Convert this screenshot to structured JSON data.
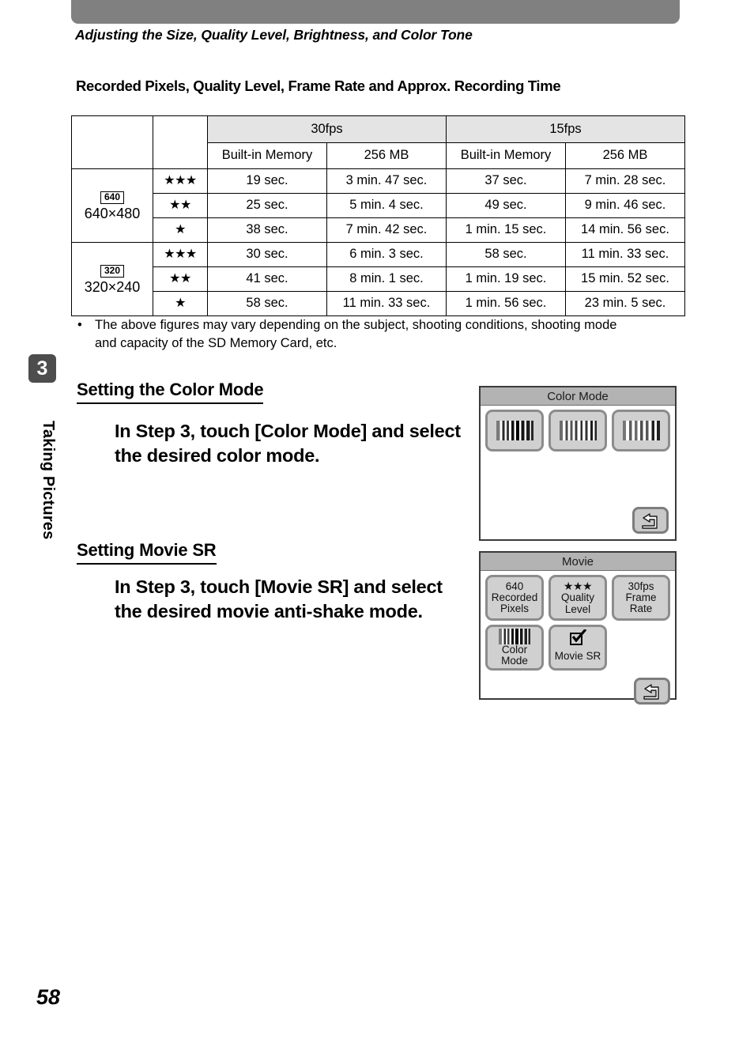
{
  "page": {
    "running_head": "Adjusting the Size, Quality Level, Brightness, and Color Tone",
    "page_number": "58",
    "chapter_number": "3",
    "chapter_label": "Taking Pictures"
  },
  "table_section": {
    "title": "Recorded Pixels, Quality Level, Frame Rate and Approx. Recording Time",
    "note_bullet": "•",
    "note_text": "The above figures may vary depending on the subject, shooting conditions, shooting mode and capacity of the SD Memory Card, etc."
  },
  "chart_data": {
    "type": "table",
    "title": "Recorded Pixels, Quality Level, Frame Rate and Approx. Recording Time",
    "group_headers": [
      "30fps",
      "15fps"
    ],
    "sub_headers": [
      "Built-in Memory",
      "256 MB",
      "Built-in Memory",
      "256 MB"
    ],
    "row_groups": [
      {
        "badge": "640",
        "resolution": "640×480",
        "rows": [
          {
            "quality": "★★★",
            "values": [
              "19 sec.",
              "3 min. 47 sec.",
              "37 sec.",
              "7 min. 28 sec."
            ]
          },
          {
            "quality": "★★",
            "values": [
              "25 sec.",
              "5 min. 4 sec.",
              "49 sec.",
              "9 min. 46 sec."
            ]
          },
          {
            "quality": "★",
            "values": [
              "38 sec.",
              "7 min. 42 sec.",
              "1 min. 15 sec.",
              "14 min. 56 sec."
            ]
          }
        ]
      },
      {
        "badge": "320",
        "resolution": "320×240",
        "rows": [
          {
            "quality": "★★★",
            "values": [
              "30 sec.",
              "6 min. 3 sec.",
              "58 sec.",
              "11 min. 33 sec."
            ]
          },
          {
            "quality": "★★",
            "values": [
              "41 sec.",
              "8 min. 1 sec.",
              "1 min. 19 sec.",
              "15 min. 52 sec."
            ]
          },
          {
            "quality": "★",
            "values": [
              "58 sec.",
              "11 min. 33 sec.",
              "1 min. 56 sec.",
              "23 min. 5 sec."
            ]
          }
        ]
      }
    ]
  },
  "sections": [
    {
      "heading": "Setting the Color Mode",
      "body": "In Step 3, touch [Color Mode] and select the desired color mode."
    },
    {
      "heading": "Setting Movie SR",
      "body": "In Step 3, touch [Movie SR] and select the desired movie anti-shake mode."
    }
  ],
  "color_mode_screen": {
    "title": "Color Mode",
    "buttons": [
      {
        "icon": "color-bar-vivid-icon"
      },
      {
        "icon": "color-bar-natural-icon"
      },
      {
        "icon": "color-bar-monochrome-icon"
      }
    ],
    "back_icon": "back-arrow-icon"
  },
  "movie_screen": {
    "title": "Movie",
    "buttons": [
      {
        "value": "640",
        "label_line1": "Recorded",
        "label_line2": "Pixels",
        "icon": ""
      },
      {
        "value": "★★★",
        "label_line1": "Quality",
        "label_line2": "Level",
        "icon": ""
      },
      {
        "value": "30fps",
        "label_line1": "Frame",
        "label_line2": "Rate",
        "icon": ""
      },
      {
        "value": "",
        "label_line1": "Color",
        "label_line2": "Mode",
        "icon": "color-bar-icon"
      },
      {
        "value": "",
        "label_line1": "Movie SR",
        "label_line2": "",
        "icon": "checkbox-checked-icon"
      }
    ],
    "back_icon": "back-arrow-icon"
  }
}
